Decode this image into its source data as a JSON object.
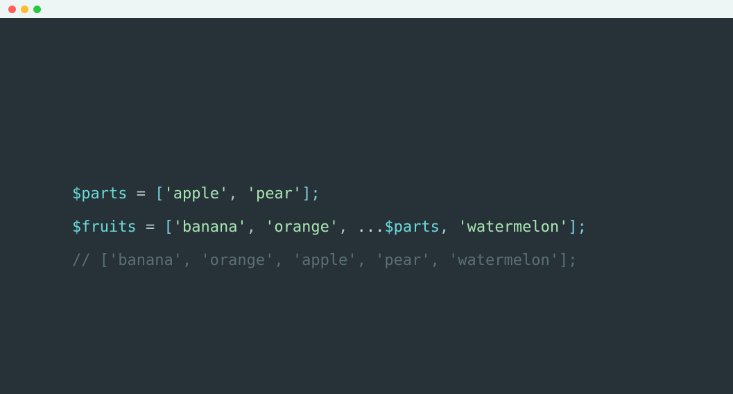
{
  "titlebar": {
    "close_color": "#ff5f57",
    "minimize_color": "#febc2e",
    "maximize_color": "#28c840"
  },
  "code": {
    "line1": {
      "var": "$parts",
      "eq": " = ",
      "lb": "[",
      "s1": "'apple'",
      "c1": ", ",
      "s2": "'pear'",
      "rb": "];"
    },
    "line2": {
      "var": "$fruits",
      "eq": " = ",
      "lb": "[",
      "s1": "'banana'",
      "c1": ", ",
      "s2": "'orange'",
      "c2": ", ",
      "spread": "...",
      "sv": "$parts",
      "c3": ", ",
      "s3": "'watermelon'",
      "rb": "];"
    },
    "line3": {
      "comment": "// ['banana', 'orange', 'apple', 'pear', 'watermelon'];"
    }
  }
}
